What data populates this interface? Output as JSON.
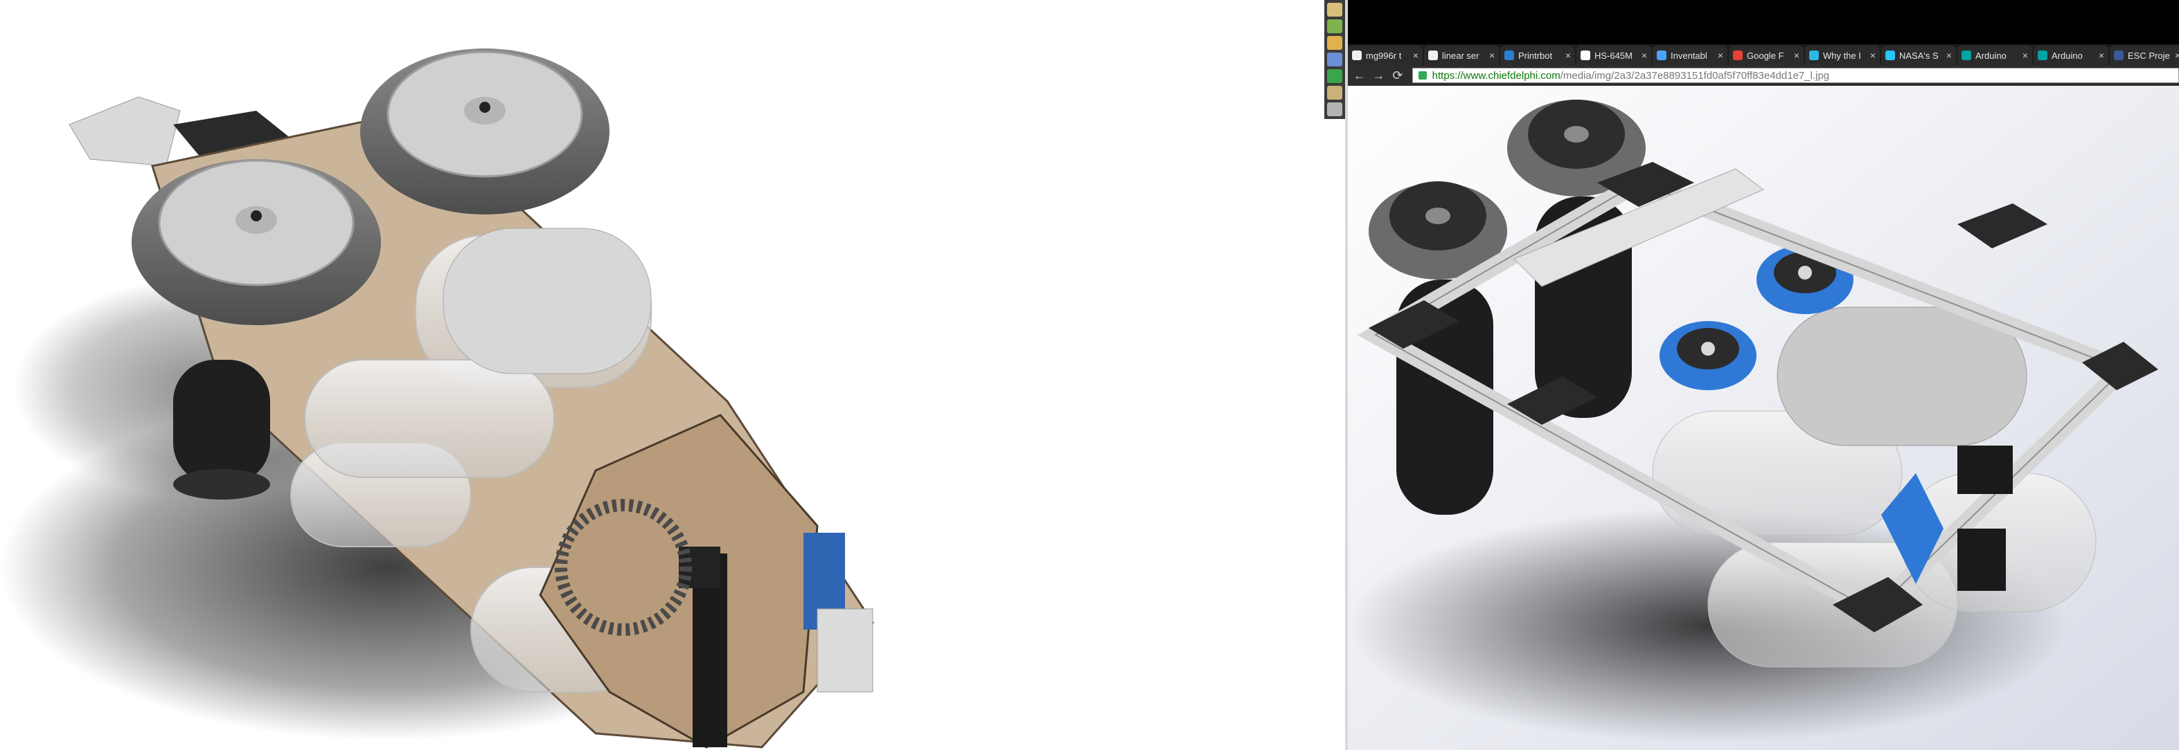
{
  "browser": {
    "tabs": [
      {
        "label": "mg996r t",
        "favicon_color": "#f0f0f0"
      },
      {
        "label": "linear ser",
        "favicon_color": "#f0f0f0"
      },
      {
        "label": "Printrbot",
        "favicon_color": "#2a7fd4"
      },
      {
        "label": "HS-645M",
        "favicon_color": "#ffffff"
      },
      {
        "label": "Inventabl",
        "favicon_color": "#4aa3ff"
      },
      {
        "label": "Google F",
        "favicon_color": "#e94235"
      },
      {
        "label": "Why the I",
        "favicon_color": "#2fb7e8"
      },
      {
        "label": "NASA's S",
        "favicon_color": "#26c6ff"
      },
      {
        "label": "Arduino",
        "favicon_color": "#00a3a3"
      },
      {
        "label": "Arduino",
        "favicon_color": "#00a3a3"
      },
      {
        "label": "ESC Proje",
        "favicon_color": "#3b5998"
      }
    ],
    "tab_close": "×",
    "nav": {
      "back": "←",
      "forward": "→",
      "reload": "⟳"
    },
    "url": {
      "scheme_host": "https://www.chiefdelphi.com",
      "path": "/media/img/2a3/2a37e8893151fd0af5f70ff83e4dd1e7_l.jpg"
    }
  },
  "colors": {
    "page_bg": "#ffffff",
    "topbar": "#000000",
    "tabstrip": "#1c1c1c"
  }
}
